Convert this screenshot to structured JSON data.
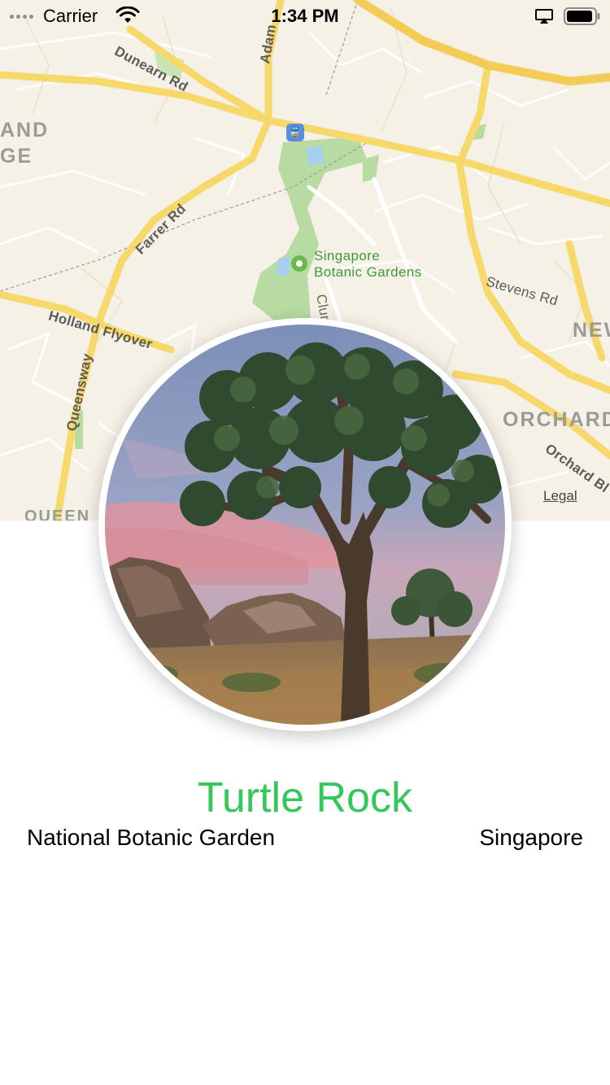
{
  "status_bar": {
    "carrier": "Carrier",
    "time": "1:34 PM"
  },
  "map": {
    "roads": {
      "dunearn": "Dunearn Rd",
      "adam": "Adam",
      "farrer": "Farrer Rd",
      "holland": "Holland Flyover",
      "queensway": "Queensway",
      "stevens": "Stevens Rd",
      "orchard_bl": "Orchard Bl",
      "cluny": "Cluny"
    },
    "districts": {
      "and": "AND",
      "ge": "GE",
      "new": "NEW",
      "orchard": "ORCHARD",
      "queen": "QUEEN"
    },
    "poi": {
      "line1": "Singapore",
      "line2": "Botanic Gardens"
    },
    "legal": "Legal"
  },
  "landmark": {
    "name": "Turtle Rock",
    "park": "National Botanic Garden",
    "state": "Singapore"
  },
  "colors": {
    "title_green": "#34c759",
    "park_green": "#b7dba0",
    "highway_yellow": "#f7d86b",
    "map_background": "#f6f1e6"
  }
}
